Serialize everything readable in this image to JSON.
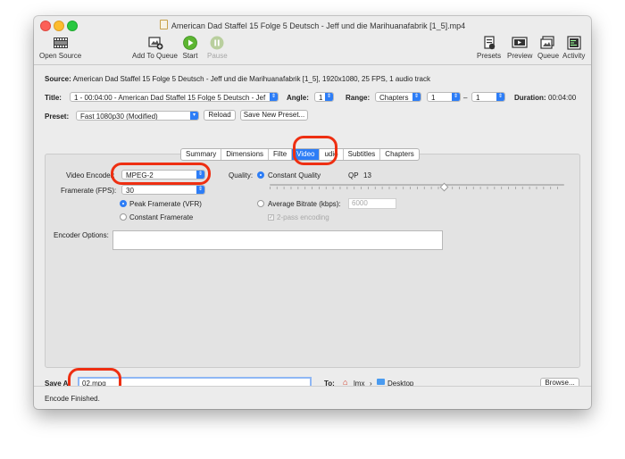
{
  "window": {
    "title": "American Dad Staffel 15 Folge 5 Deutsch - Jeff und die Marihuanafabrik [1_5].mp4"
  },
  "toolbar": {
    "open_source": "Open Source",
    "add_to_queue": "Add To Queue",
    "start": "Start",
    "pause": "Pause",
    "presets": "Presets",
    "preview": "Preview",
    "queue": "Queue",
    "activity": "Activity"
  },
  "source": {
    "label": "Source:",
    "value": "American Dad Staffel 15 Folge 5 Deutsch - Jeff und die Marihuanafabrik [1_5], 1920x1080, 25 FPS, 1 audio track"
  },
  "title_row": {
    "title_label": "Title:",
    "title_value": "1 - 00:04:00 - American Dad Staffel 15 Folge 5 Deutsch - Jef",
    "angle_label": "Angle:",
    "angle_value": "1",
    "range_label": "Range:",
    "range_type": "Chapters",
    "range_start": "1",
    "range_dash": "–",
    "range_end": "1",
    "duration_label": "Duration:",
    "duration_value": "00:04:00"
  },
  "preset_row": {
    "label": "Preset:",
    "value": "Fast 1080p30 (Modified)",
    "reload": "Reload",
    "save_new": "Save New Preset..."
  },
  "tabs": [
    "Summary",
    "Dimensions",
    "Filters",
    "Video",
    "Audio",
    "Subtitles",
    "Chapters"
  ],
  "tabs_display": [
    "Summary",
    "Dimensions",
    "Filte",
    "Video",
    "udio",
    "Subtitles",
    "Chapters"
  ],
  "active_tab": "Video",
  "video": {
    "encoder_label": "Video Encoder:",
    "encoder_value": "MPEG-2",
    "framerate_label": "Framerate (FPS):",
    "framerate_value": "30",
    "peak_framerate": "Peak Framerate (VFR)",
    "constant_framerate": "Constant Framerate",
    "quality_label": "Quality:",
    "constant_quality": "Constant Quality",
    "qp_label": "QP",
    "qp_value": "13",
    "avg_bitrate": "Average Bitrate (kbps):",
    "bitrate_value": "6000",
    "two_pass": "2-pass encoding",
    "encoder_options_label": "Encoder Options:"
  },
  "save": {
    "label": "Save As:",
    "label_visible": "Save A",
    "value": "02.mpg",
    "to_label": "To:",
    "path_user": "lmx",
    "path_folder": "Desktop",
    "browse": "Browse..."
  },
  "status": {
    "text": "Encode Finished."
  },
  "colors": {
    "accent": "#2d7df6",
    "highlight": "#ee2f12",
    "start_green": "#5cb531"
  }
}
